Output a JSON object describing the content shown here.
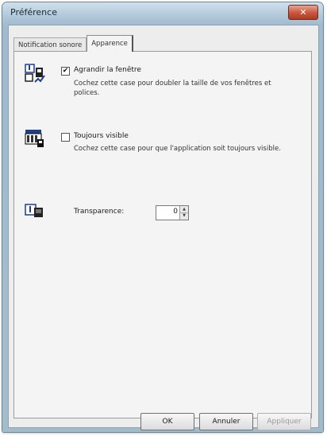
{
  "window": {
    "title": "Préférence",
    "close_label": "✕"
  },
  "tabs": [
    {
      "label": "Notification sonore",
      "active": false
    },
    {
      "label": "Apparence",
      "active": true
    }
  ],
  "options": {
    "enlarge": {
      "label": "Agrandir la fenêtre",
      "checked": true,
      "check_glyph": "✔",
      "description": "Cochez cette case pour doubler la taille de vos fenêtres et polices."
    },
    "always_visible": {
      "label": "Toujours visible",
      "checked": false,
      "description": "Cochez cette case pour que l'application soit toujours visible."
    },
    "transparency": {
      "label": "Transparence:",
      "value": "0"
    }
  },
  "footer": {
    "ok_label": "OK",
    "cancel_label": "Annuler",
    "apply_label": "Appliquer"
  },
  "icons": {
    "enlarge": "enlarge-window-icon",
    "visible": "always-on-top-icon",
    "transparency": "transparency-icon"
  }
}
